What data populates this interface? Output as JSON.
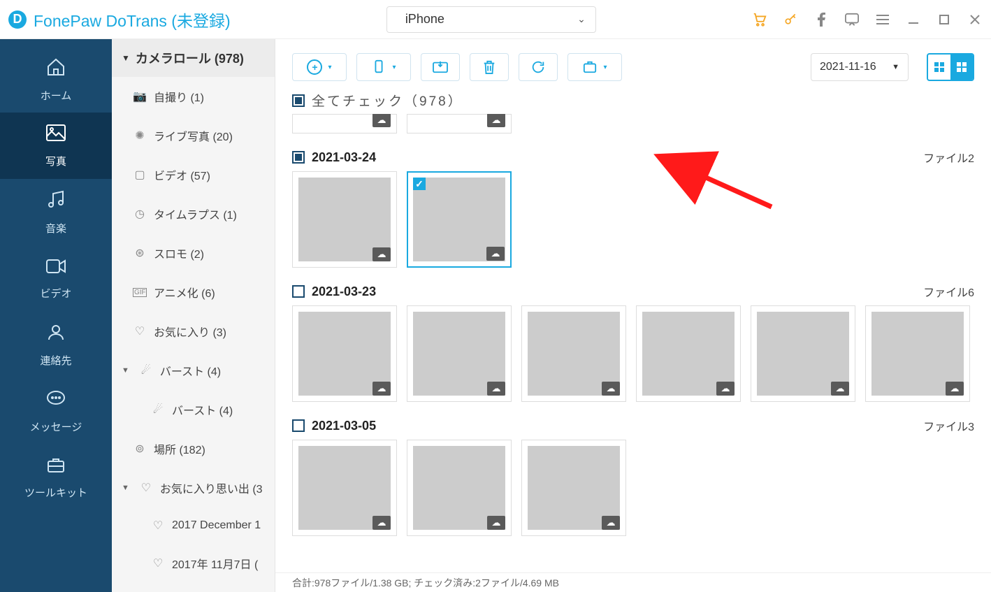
{
  "app": {
    "title": "FonePaw DoTrans",
    "unreg": "(未登録)"
  },
  "device": {
    "name": "iPhone"
  },
  "nav": {
    "home": "ホーム",
    "photos": "写真",
    "music": "音楽",
    "videos": "ビデオ",
    "contacts": "連絡先",
    "messages": "メッセージ",
    "toolkit": "ツールキット"
  },
  "tree": {
    "header": "カメラロール (978)",
    "items": [
      {
        "icon": "📷",
        "label": "自撮り (1)"
      },
      {
        "icon": "✺",
        "label": "ライブ写真 (20)"
      },
      {
        "icon": "▢",
        "label": "ビデオ (57)"
      },
      {
        "icon": "◷",
        "label": "タイムラプス (1)"
      },
      {
        "icon": "⊛",
        "label": "スロモ (2)"
      },
      {
        "icon": "GIF",
        "label": "アニメ化 (6)"
      },
      {
        "icon": "♡",
        "label": "お気に入り (3)"
      }
    ],
    "burst": {
      "label": "バースト (4)",
      "child": "バースト (4)"
    },
    "places": {
      "icon": "⊚",
      "label": "場所 (182)"
    },
    "fav_mem": {
      "label": "お気に入り思い出 (3",
      "children": [
        "2017 December 1",
        "2017年 11月7日 ("
      ]
    }
  },
  "dateFilter": "2021-11-16",
  "checkAll": "全てチェック（978）",
  "groups": [
    {
      "date": "2021-03-24",
      "countLabel": "ファイル2",
      "state": "indet",
      "thumbs": 2
    },
    {
      "date": "2021-03-23",
      "countLabel": "ファイル6",
      "state": "empty",
      "thumbs": 6
    },
    {
      "date": "2021-03-05",
      "countLabel": "ファイル3",
      "state": "empty",
      "thumbs": 3
    }
  ],
  "status": "合計:978ファイル/1.38 GB; チェック済み:2ファイル/4.69 MB"
}
